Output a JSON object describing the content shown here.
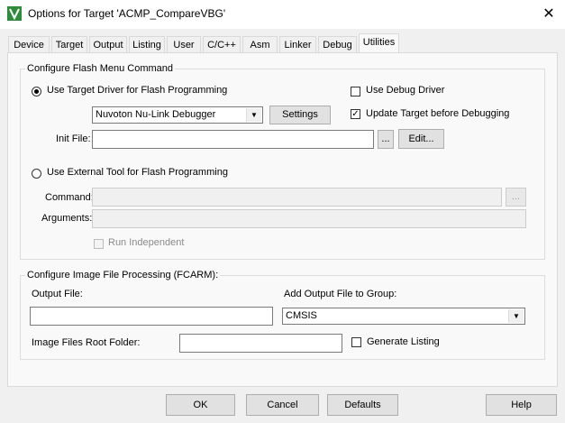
{
  "window": {
    "title": "Options for Target 'ACMP_CompareVBG'",
    "icon": "keil-uvision-icon",
    "close": "✕"
  },
  "tabs": [
    "Device",
    "Target",
    "Output",
    "Listing",
    "User",
    "C/C++",
    "Asm",
    "Linker",
    "Debug",
    "Utilities"
  ],
  "active_tab": "Utilities",
  "flash_group": {
    "title": "Configure Flash Menu Command",
    "use_target_driver_label": "Use Target Driver for Flash Programming",
    "use_target_driver_selected": true,
    "driver_select_value": "Nuvoton Nu-Link Debugger",
    "settings_button": "Settings",
    "use_debug_driver_label": "Use Debug Driver",
    "use_debug_driver_checked": false,
    "update_target_label": "Update Target before Debugging",
    "update_target_checked": true,
    "init_file_label": "Init File:",
    "init_file_value": "",
    "browse_button": "...",
    "edit_button": "Edit...",
    "use_external_tool_label": "Use External Tool for Flash Programming",
    "use_external_tool_selected": false,
    "command_label": "Command:",
    "command_value": "",
    "command_browse_button": "...",
    "arguments_label": "Arguments:",
    "arguments_value": "",
    "run_independent_label": "Run Independent",
    "run_independent_checked": false
  },
  "image_group": {
    "title": "Configure Image File Processing (FCARM):",
    "output_file_label": "Output File:",
    "output_file_value": "",
    "add_output_label": "Add Output File  to Group:",
    "group_select_value": "CMSIS",
    "root_folder_label": "Image Files Root Folder:",
    "root_folder_value": "",
    "generate_listing_label": "Generate Listing",
    "generate_listing_checked": false
  },
  "footer": {
    "ok": "OK",
    "cancel": "Cancel",
    "defaults": "Defaults",
    "help": "Help"
  }
}
